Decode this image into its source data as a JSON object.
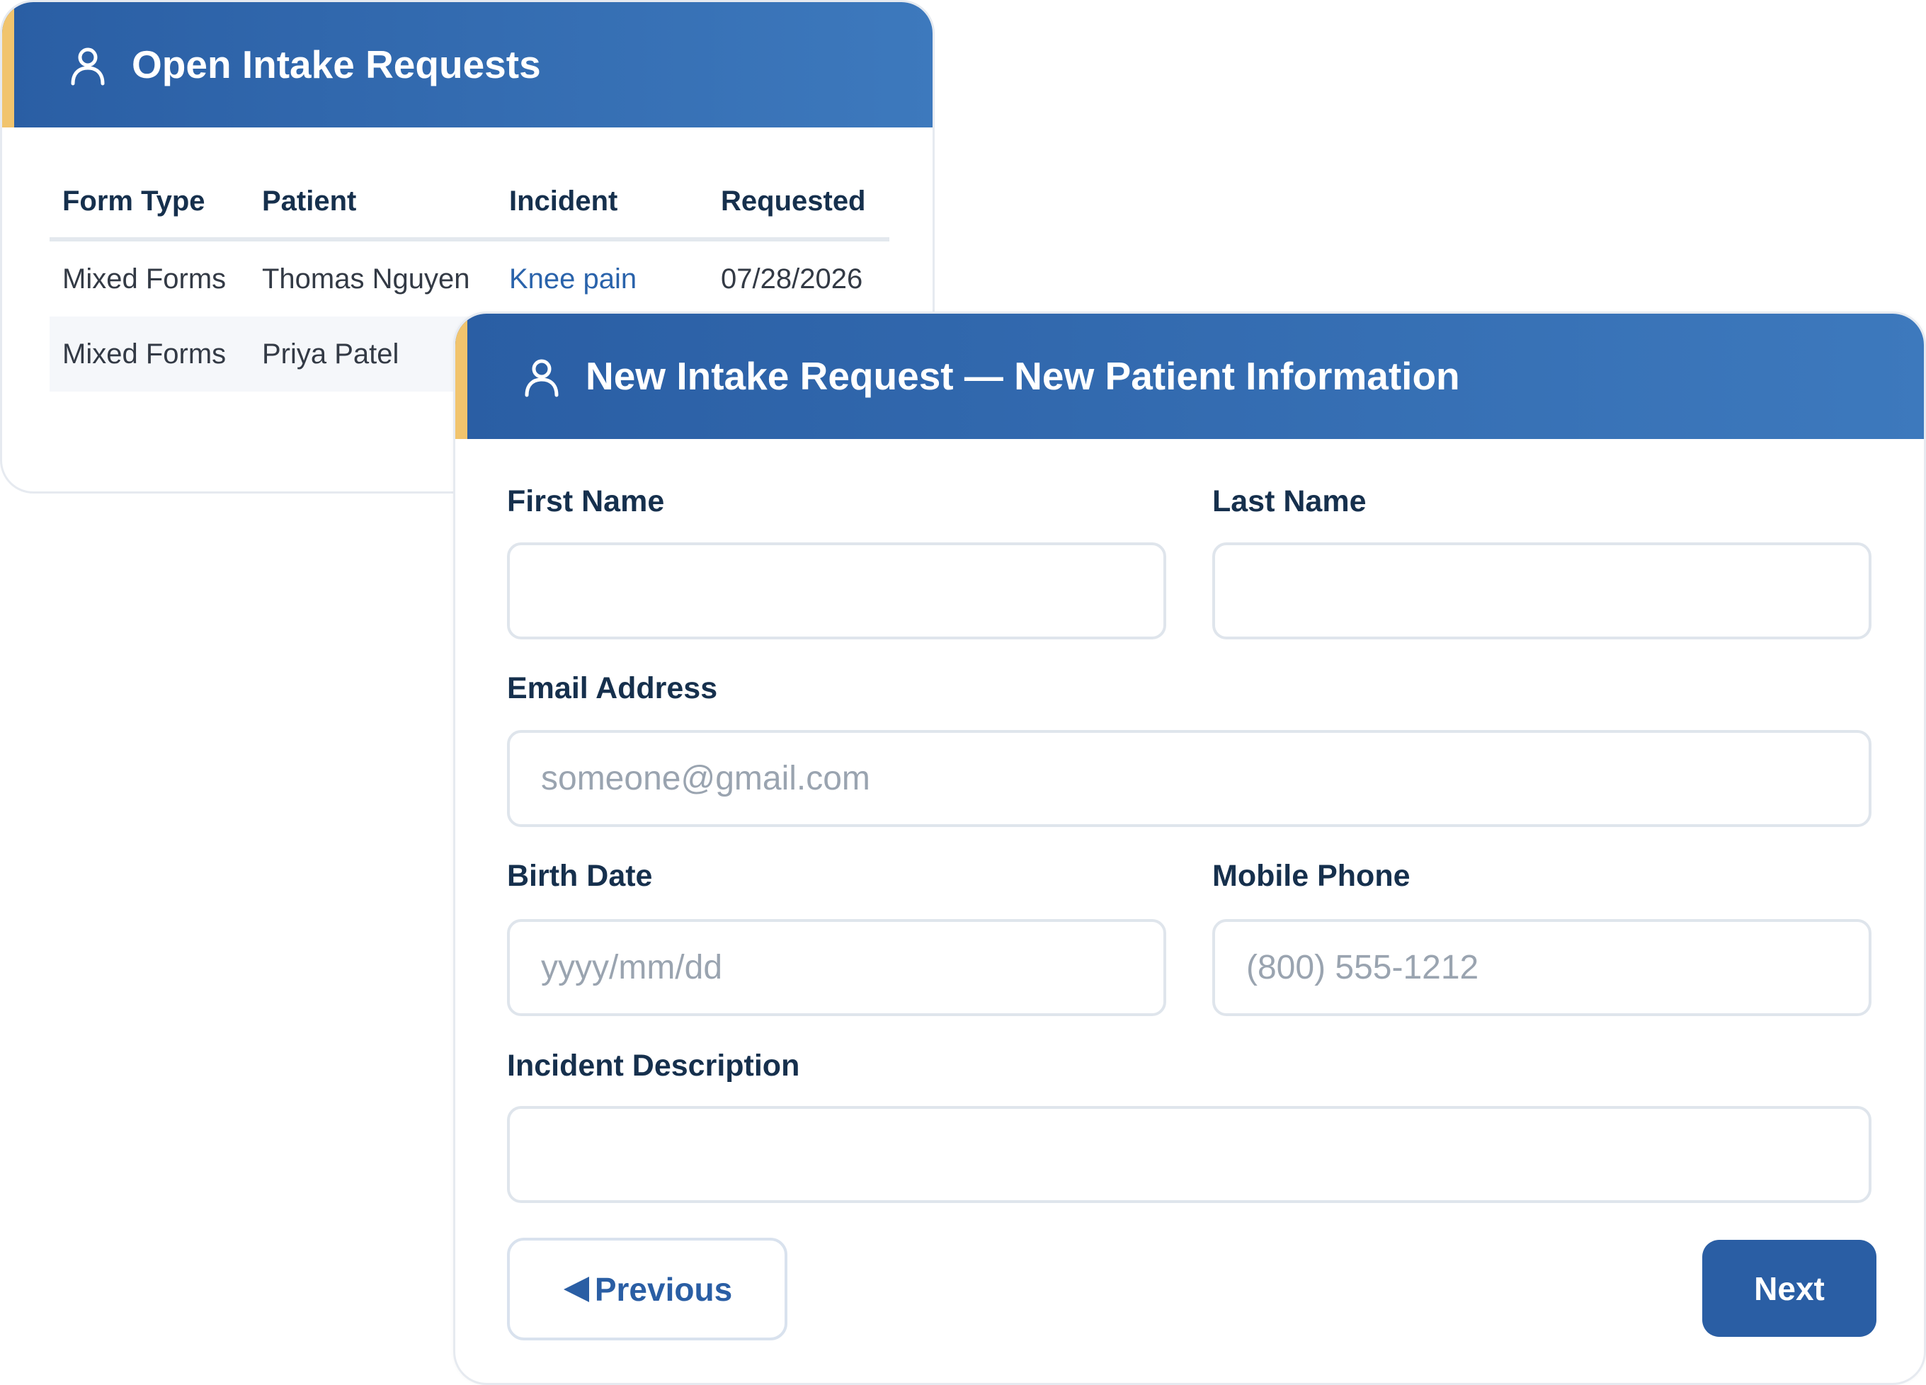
{
  "open_requests": {
    "title": "Open Intake Requests",
    "header_icon": "user-icon",
    "columns": [
      "Form Type",
      "Patient",
      "Incident",
      "Requested"
    ],
    "rows": [
      {
        "form_type": "Mixed Forms",
        "patient": "Thomas Nguyen",
        "incident": "Knee pain",
        "requested": "07/28/2026"
      },
      {
        "form_type": "Mixed Forms",
        "patient": "Priya Patel",
        "incident": "",
        "requested": ""
      }
    ]
  },
  "new_request": {
    "title": "New Intake Request — New Patient Information",
    "header_icon": "user-icon",
    "fields": {
      "first_name": {
        "label": "First Name",
        "value": "",
        "placeholder": ""
      },
      "last_name": {
        "label": "Last Name",
        "value": "",
        "placeholder": ""
      },
      "email": {
        "label": "Email Address",
        "value": "",
        "placeholder": "someone@gmail.com"
      },
      "birth_date": {
        "label": "Birth Date",
        "value": "",
        "placeholder": "yyyy/mm/dd"
      },
      "mobile_phone": {
        "label": "Mobile Phone",
        "value": "",
        "placeholder": "(800) 555-1212"
      },
      "incident_description": {
        "label": "Incident Description",
        "value": "",
        "placeholder": ""
      }
    },
    "previous_label": "Previous",
    "previous_icon": "triangle-left-icon",
    "next_label": "Next"
  },
  "colors": {
    "header_start": "#2a5ea4",
    "header_end": "#3d79bd",
    "accent": "#f1c46d",
    "link": "#2a63ab",
    "label": "#16304d"
  }
}
